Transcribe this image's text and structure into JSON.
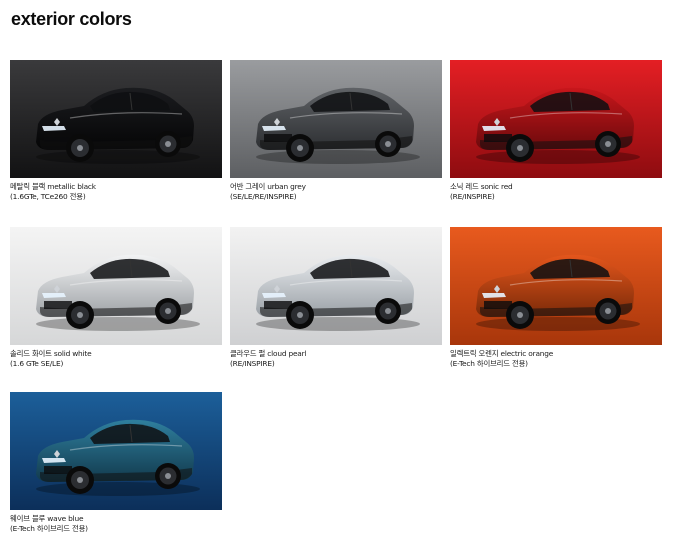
{
  "page": {
    "title": "exterior colors"
  },
  "colors": [
    {
      "name": "메탈릭 블랙 metallic black",
      "note": "(1.6GTe, TCe260 전용)",
      "body": "#1b1c1f",
      "shade": "#050506",
      "bg_top": "#3a3a3c",
      "bg_bottom": "#121213"
    },
    {
      "name": "어반 그레이 urban grey",
      "note": "(SE/LE/RE/INSPIRE)",
      "body": "#5f6266",
      "shade": "#2d2f32",
      "bg_top": "#9a9c9f",
      "bg_bottom": "#5d5f62"
    },
    {
      "name": "소닉 레드 sonic red",
      "note": "(RE/INSPIRE)",
      "body": "#c8161b",
      "shade": "#6b0a0c",
      "bg_top": "#e41f24",
      "bg_bottom": "#8e0c10"
    },
    {
      "name": "솔리드 화이트 solid white",
      "note": "(1.6 GTe SE/LE)",
      "body": "#f2f3f4",
      "shade": "#9ea2a6",
      "bg_top": "#f4f4f4",
      "bg_bottom": "#d6d7d8"
    },
    {
      "name": "클라우드 펄 cloud pearl",
      "note": "(RE/INSPIRE)",
      "body": "#e9ecef",
      "shade": "#9aa0a6",
      "bg_top": "#f2f2f2",
      "bg_bottom": "#cfd0d2"
    },
    {
      "name": "일렉트릭 오렌지 electric orange",
      "note": "(E-Tech 하이브리드 전용)",
      "body": "#e4561c",
      "shade": "#7a2a08",
      "bg_top": "#e85a1e",
      "bg_bottom": "#a8360b"
    },
    {
      "name": "웨이브 블루 wave blue",
      "note": "(E-Tech 하이브리드 전용)",
      "body": "#2f7f9e",
      "shade": "#123a4d",
      "bg_top": "#1c5f9a",
      "bg_bottom": "#0c2f5a"
    }
  ]
}
